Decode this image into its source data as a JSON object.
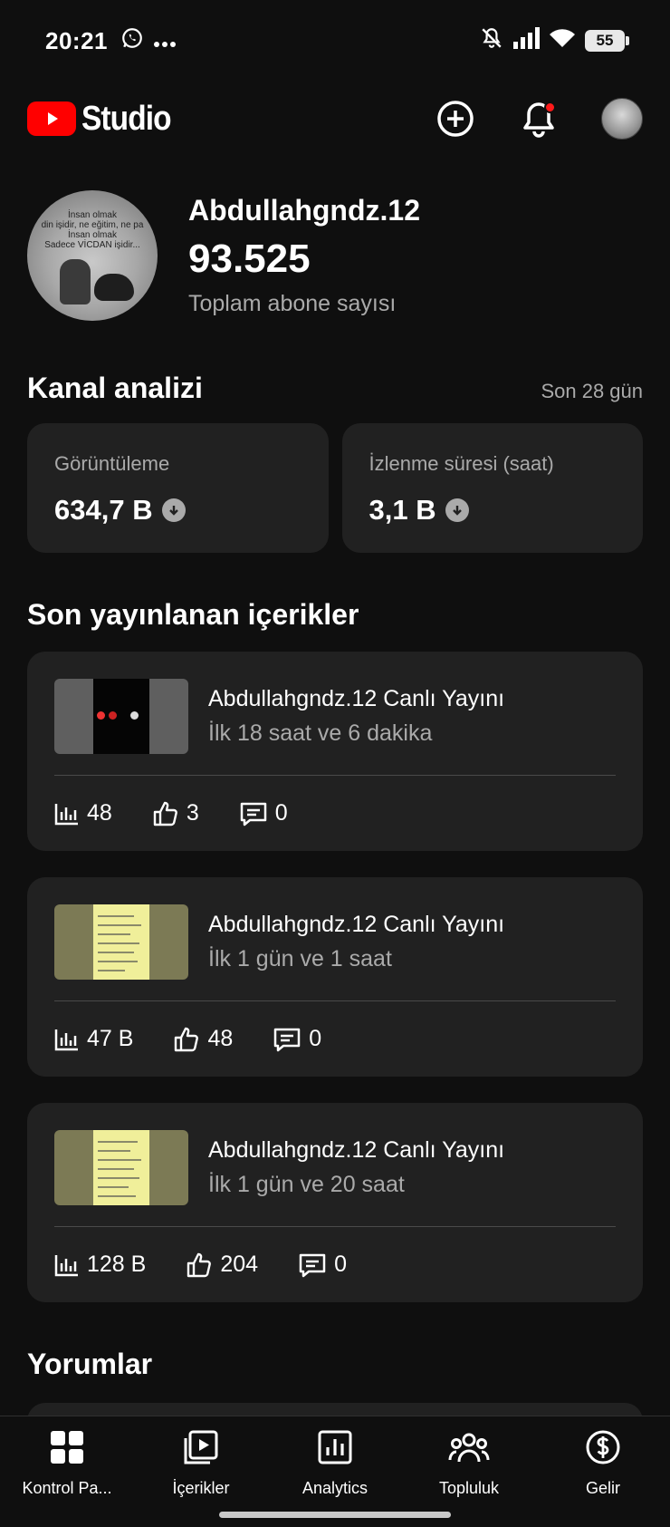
{
  "status_bar": {
    "time": "20:21",
    "battery": "55",
    "icons": [
      "whatsapp-icon",
      "more-dots-icon",
      "mute-icon",
      "signal-icon",
      "wifi-icon",
      "battery-icon"
    ]
  },
  "app_bar": {
    "logo_word": "Studio",
    "actions": [
      "create-icon",
      "notifications-icon",
      "account-avatar"
    ],
    "brand_color": "#ff0000"
  },
  "channel": {
    "name": "Abdullahgndz.12",
    "subscriber_count": "93.525",
    "subscriber_label": "Toplam abone sayısı",
    "avatar_text": [
      "İnsan olmak",
      "din işidir, ne eğitim, ne pa",
      "İnsan olmak",
      "Sadece VİCDAN işidir..."
    ]
  },
  "analytics": {
    "title": "Kanal analizi",
    "period": "Son 28 gün",
    "cards": [
      {
        "label": "Görüntüleme",
        "value": "634,7 B",
        "trend_icon": "trend-down-icon"
      },
      {
        "label": "İzlenme süresi (saat)",
        "value": "3,1 B",
        "trend_icon": "trend-down-icon"
      }
    ]
  },
  "recent": {
    "title": "Son yayınlanan içerikler",
    "items": [
      {
        "title": "Abdullahgndz.12 Canlı Yayını",
        "subtitle": "İlk 18 saat ve 6 dakika",
        "views": "48",
        "likes": "3",
        "comments": "0"
      },
      {
        "title": "Abdullahgndz.12 Canlı Yayını",
        "subtitle": "İlk 1 gün ve 1 saat",
        "views": "47 B",
        "likes": "48",
        "comments": "0"
      },
      {
        "title": "Abdullahgndz.12 Canlı Yayını",
        "subtitle": "İlk 1 gün ve 20 saat",
        "views": "128 B",
        "likes": "204",
        "comments": "0"
      }
    ]
  },
  "comments": {
    "title": "Yorumlar"
  },
  "bottom_nav": {
    "items": [
      {
        "label": "Kontrol Pa...",
        "icon": "dashboard-icon"
      },
      {
        "label": "İçerikler",
        "icon": "content-icon"
      },
      {
        "label": "Analytics",
        "icon": "analytics-icon"
      },
      {
        "label": "Topluluk",
        "icon": "community-icon"
      },
      {
        "label": "Gelir",
        "icon": "earn-icon"
      }
    ]
  }
}
